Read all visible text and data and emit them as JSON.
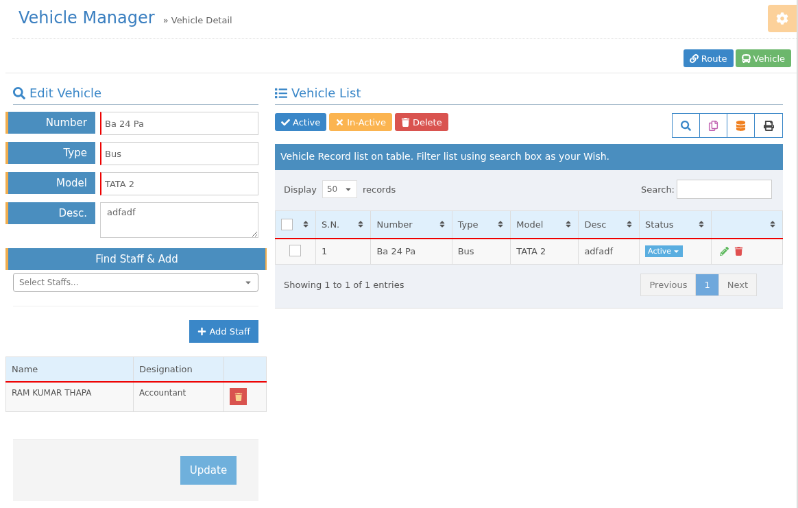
{
  "header": {
    "title": "Vehicle Manager",
    "breadcrumb": "» Vehicle Detail"
  },
  "top_buttons": [
    {
      "label": "Route",
      "kind": "route"
    },
    {
      "label": "Vehicle",
      "kind": "vehicle"
    }
  ],
  "edit_panel": {
    "title": "Edit Vehicle",
    "fields": [
      {
        "label": "Number",
        "value": "Ba 24 Pa",
        "kind": "input"
      },
      {
        "label": "Type",
        "value": "Bus",
        "kind": "input"
      },
      {
        "label": "Model",
        "value": "TATA 2",
        "kind": "input"
      },
      {
        "label": "Desc.",
        "value": "adfadf",
        "kind": "textarea"
      }
    ],
    "staff_header": "Find Staff & Add",
    "staff_select": {
      "placeholder": "Select Staffs..."
    },
    "add_button": "Add Staff",
    "staff_table": {
      "columns": [
        "Name",
        "Designation"
      ],
      "rows": [
        {
          "name": "RAM KUMAR THAPA",
          "designation": "Accountant"
        }
      ]
    },
    "update_button": {
      "label": "Update",
      "disabled": true
    }
  },
  "list_panel": {
    "title": "Vehicle List",
    "actions": [
      {
        "label": "Active",
        "kind": "active"
      },
      {
        "label": "In-Active",
        "kind": "inactive"
      },
      {
        "label": "Delete",
        "kind": "delete"
      }
    ],
    "info": "Vehicle Record list on table. Filter list using search box as your Wish.",
    "display_label": "Display",
    "page_size": "50",
    "records_label": "records",
    "search_label": "Search:",
    "columns": [
      "S.N.",
      "Number",
      "Type",
      "Model",
      "Desc",
      "Status"
    ],
    "header_checked": false,
    "rows": [
      {
        "checked": false,
        "cells": [
          "1",
          "Ba 24 Pa",
          "Bus",
          "TATA 2",
          "adfadf"
        ],
        "status": "Active"
      }
    ],
    "summary": "Showing 1 to 1 of 1 entries",
    "pages": [
      {
        "label": "Previous",
        "selected": false
      },
      {
        "label": "1",
        "selected": true
      },
      {
        "label": "Next",
        "selected": false
      }
    ]
  }
}
